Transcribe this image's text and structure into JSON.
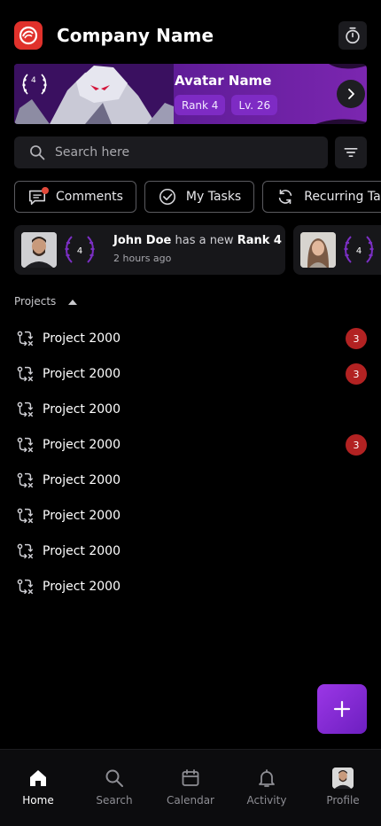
{
  "header": {
    "company_name": "Company Name",
    "logo_icon": "company-logo",
    "timer_icon": "stopwatch-icon",
    "brand_color": "#e0312b"
  },
  "hero": {
    "avatar_name": "Avatar Name",
    "laurel_rank": "4",
    "rank_chip": "Rank 4",
    "level_chip": "Lv. 26",
    "accent_color": "#6a1fa8"
  },
  "search": {
    "placeholder": "Search here",
    "value": ""
  },
  "tabs": [
    {
      "label": "Comments",
      "icon": "comment-icon",
      "has_dot": true
    },
    {
      "label": "My Tasks",
      "icon": "check-circle-icon"
    },
    {
      "label": "Recurring Ta",
      "icon": "repeat-icon"
    }
  ],
  "activity": [
    {
      "user": "John Doe",
      "text": "has a new",
      "highlight": "Rank 4",
      "time": "2 hours ago",
      "rank": "4"
    },
    {
      "rank": "4"
    }
  ],
  "projects": {
    "heading": "Projects",
    "items": [
      {
        "name": "Project 2000",
        "badge": "3"
      },
      {
        "name": "Project 2000",
        "badge": "3"
      },
      {
        "name": "Project 2000",
        "badge": ""
      },
      {
        "name": "Project 2000",
        "badge": "3"
      },
      {
        "name": "Project 2000",
        "badge": ""
      },
      {
        "name": "Project 2000",
        "badge": ""
      },
      {
        "name": "Project 2000",
        "badge": ""
      },
      {
        "name": "Project 2000",
        "badge": ""
      }
    ]
  },
  "fab": {
    "icon": "plus-icon",
    "color": "#8a2be2"
  },
  "nav": [
    {
      "label": "Home",
      "icon": "home-icon",
      "active": true
    },
    {
      "label": "Search",
      "icon": "search-icon"
    },
    {
      "label": "Calendar",
      "icon": "calendar-icon"
    },
    {
      "label": "Activity",
      "icon": "bell-icon"
    },
    {
      "label": "Profile",
      "icon": "avatar"
    }
  ]
}
